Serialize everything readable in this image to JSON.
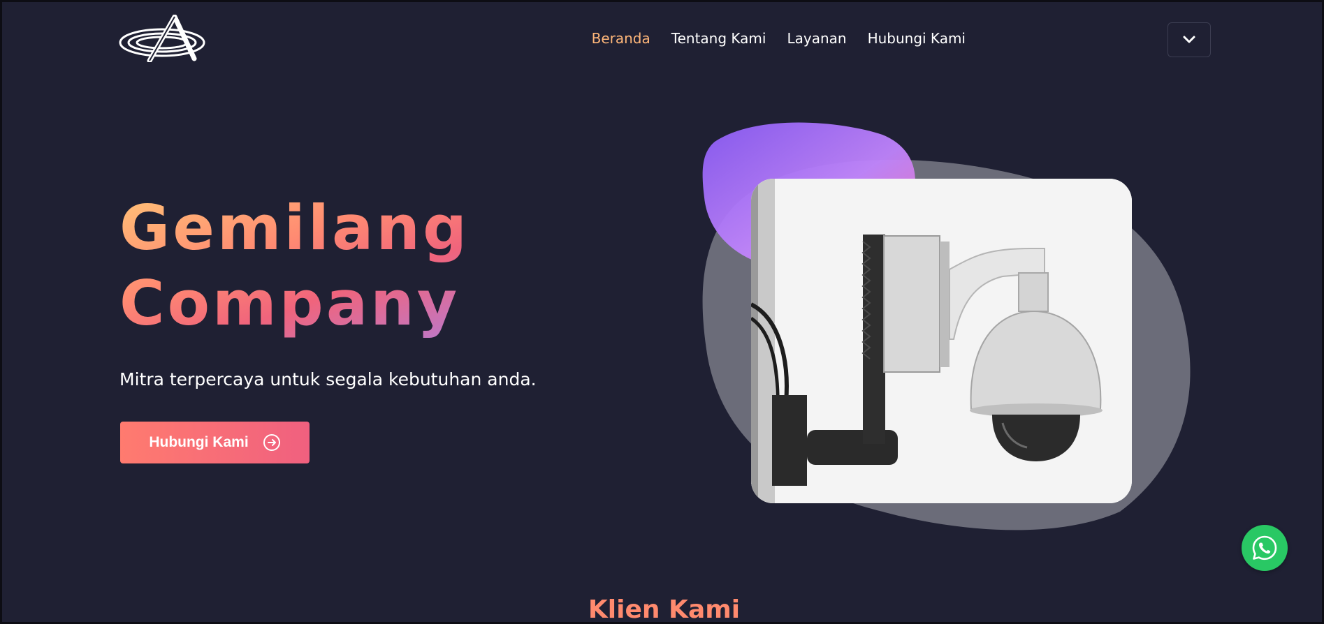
{
  "brand": {
    "logo_icon": "orbit-a-logo-icon"
  },
  "nav": {
    "items": [
      {
        "label": "Beranda",
        "active": true
      },
      {
        "label": "Tentang Kami",
        "active": false
      },
      {
        "label": "Layanan",
        "active": false
      },
      {
        "label": "Hubungi Kami",
        "active": false
      }
    ],
    "toggle_icon": "chevron-down-icon"
  },
  "hero": {
    "title_line1": "Gemilang",
    "title_line2": "Company",
    "tagline": "Mitra terpercaya untuk segala kebutuhan anda.",
    "cta_label": "Hubungi Kami",
    "cta_icon": "arrow-right-circle-icon",
    "image_subject": "security-camera-photo"
  },
  "floating": {
    "whatsapp_icon": "whatsapp-icon"
  },
  "sections": {
    "clients_title": "Klien Kami"
  },
  "colors": {
    "background": "#1f2033",
    "nav_active": "#ffb77a",
    "accent_orange": "#ff8a6e",
    "accent_pink": "#f0607f",
    "whatsapp_green": "#29c864"
  }
}
